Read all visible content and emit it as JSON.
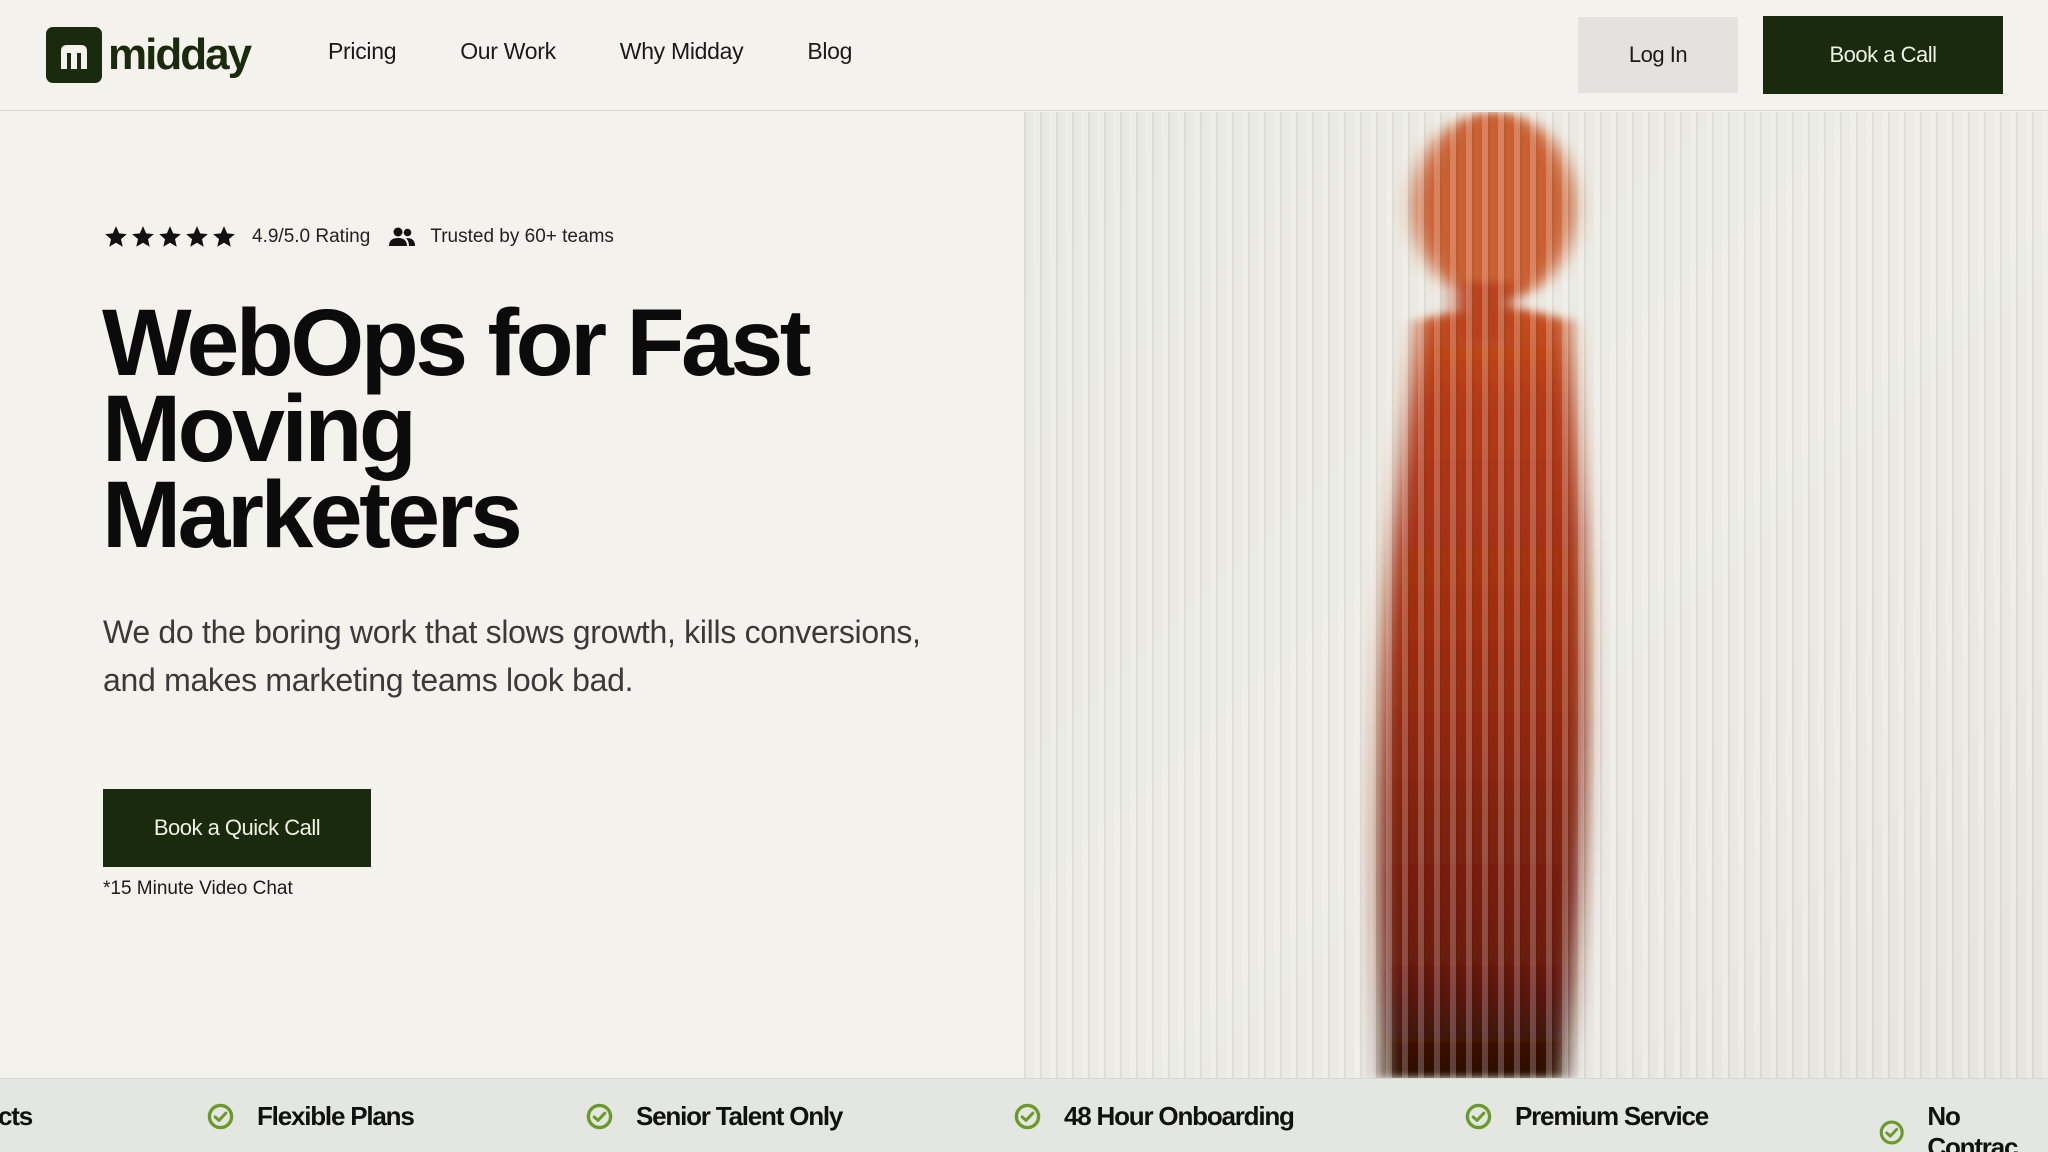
{
  "brand": {
    "name": "midday",
    "color": "#1a2a0c"
  },
  "nav": {
    "links": [
      "Pricing",
      "Our Work",
      "Why Midday",
      "Blog"
    ],
    "login_label": "Log In",
    "book_label": "Book a Call"
  },
  "hero": {
    "rating": {
      "stars": 5,
      "text": "4.9/5.0 Rating"
    },
    "trusted": "Trusted by 60+ teams",
    "headline_lines": [
      "WebOps for Fast",
      "Moving",
      "Marketers"
    ],
    "subtext": "We do the boring work that slows growth, kills conversions, and makes marketing teams look bad.",
    "cta_label": "Book a Quick Call",
    "cta_note": "*15 Minute Video Chat"
  },
  "marquee": {
    "items": [
      "cts",
      "Flexible Plans",
      "Senior Talent Only",
      "48 Hour Onboarding",
      "Premium Service",
      "No Contrac"
    ],
    "check_color": "#6a9a2a"
  },
  "icons": [
    "star-icon",
    "team-icon",
    "check-circle-icon",
    "logo-icon"
  ]
}
